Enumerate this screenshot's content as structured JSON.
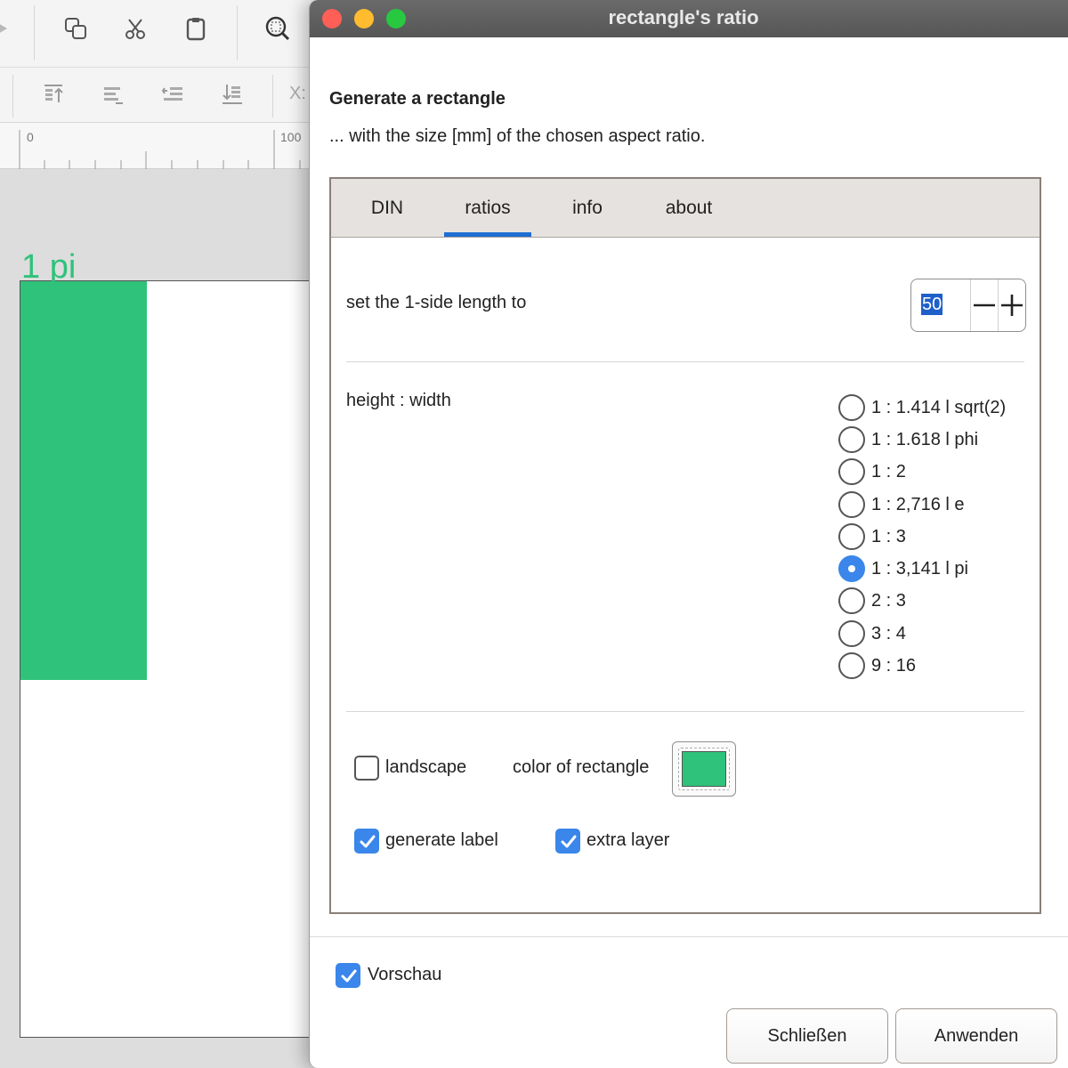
{
  "background_app": {
    "ruler_marks": [
      "0",
      "100"
    ],
    "toolbar_fragment": "X:",
    "canvas_label": "1  pi"
  },
  "dialog": {
    "title": "rectangle's ratio",
    "heading": "Generate a rectangle",
    "subheading": "... with the size [mm] of the chosen aspect ratio.",
    "tabs": [
      {
        "label": "DIN",
        "active": false
      },
      {
        "label": "ratios",
        "active": true
      },
      {
        "label": "info",
        "active": false
      },
      {
        "label": "about",
        "active": false
      }
    ],
    "side_length": {
      "label": "set the 1-side length to",
      "value": "50",
      "minus": "−",
      "plus": "+"
    },
    "ratio_group": {
      "label": "height : width",
      "options": [
        {
          "label": "1 : 1.414 l sqrt(2)",
          "selected": false
        },
        {
          "label": "1 : 1.618 l phi",
          "selected": false
        },
        {
          "label": "1 : 2",
          "selected": false
        },
        {
          "label": "1 : 2,716 l e",
          "selected": false
        },
        {
          "label": "1 : 3",
          "selected": false
        },
        {
          "label": "1 : 3,141 l pi",
          "selected": true
        },
        {
          "label": "2 : 3",
          "selected": false
        },
        {
          "label": "3 : 4",
          "selected": false
        },
        {
          "label": "9 : 16",
          "selected": false
        }
      ]
    },
    "landscape": {
      "label": "landscape",
      "checked": false
    },
    "color": {
      "label": "color of rectangle",
      "value": "#2fc27a"
    },
    "generate_label": {
      "label": "generate label",
      "checked": true
    },
    "extra_layer": {
      "label": "extra layer",
      "checked": true
    },
    "preview": {
      "label": "Vorschau",
      "checked": true
    },
    "buttons": {
      "close": "Schließen",
      "apply": "Anwenden"
    }
  },
  "colors": {
    "accent": "#1e6fd1",
    "checkbox_blue": "#3a86ea",
    "rectangle_green": "#2fc27a",
    "traffic_red": "#ff5f57",
    "traffic_yellow": "#febc2e",
    "traffic_green": "#28c840"
  }
}
